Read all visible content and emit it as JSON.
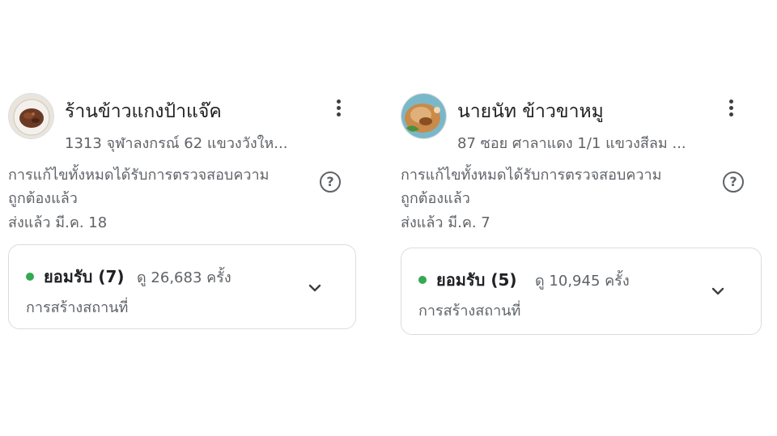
{
  "cards": [
    {
      "title": "ร้านข้าวแกงป้าแจ๊ค",
      "address": "1313 จุฬาลงกรณ์ 62 แขวงวังให...",
      "avatar_icon": "food-photo-curry",
      "more_icon": "more-vert-icon",
      "status_line1": "การแก้ไขทั้งหมดได้รับการตรวจสอบความ",
      "status_line2": "ถูกต้องแล้ว",
      "sent": "ส่งแล้ว มี.ค. 18",
      "help_icon": "?",
      "accepted": "ยอมรับ (7)",
      "views": "ดู 26,683 ครั้ง",
      "type": "การสร้างสถานที่",
      "status_color": "#34a853"
    },
    {
      "title": "นายนัท ข้าวขาหมู",
      "address": "87 ซอย ศาลาแดง 1/1 แขวงสีลม ...",
      "avatar_icon": "food-photo-pork-leg",
      "more_icon": "more-vert-icon",
      "status_line1": "การแก้ไขทั้งหมดได้รับการตรวจสอบความ",
      "status_line2": "ถูกต้องแล้ว",
      "sent": "ส่งแล้ว มี.ค. 7",
      "help_icon": "?",
      "accepted": "ยอมรับ (5)",
      "views": "ดู 10,945 ครั้ง",
      "type": "การสร้างสถานที่",
      "status_color": "#34a853"
    }
  ]
}
